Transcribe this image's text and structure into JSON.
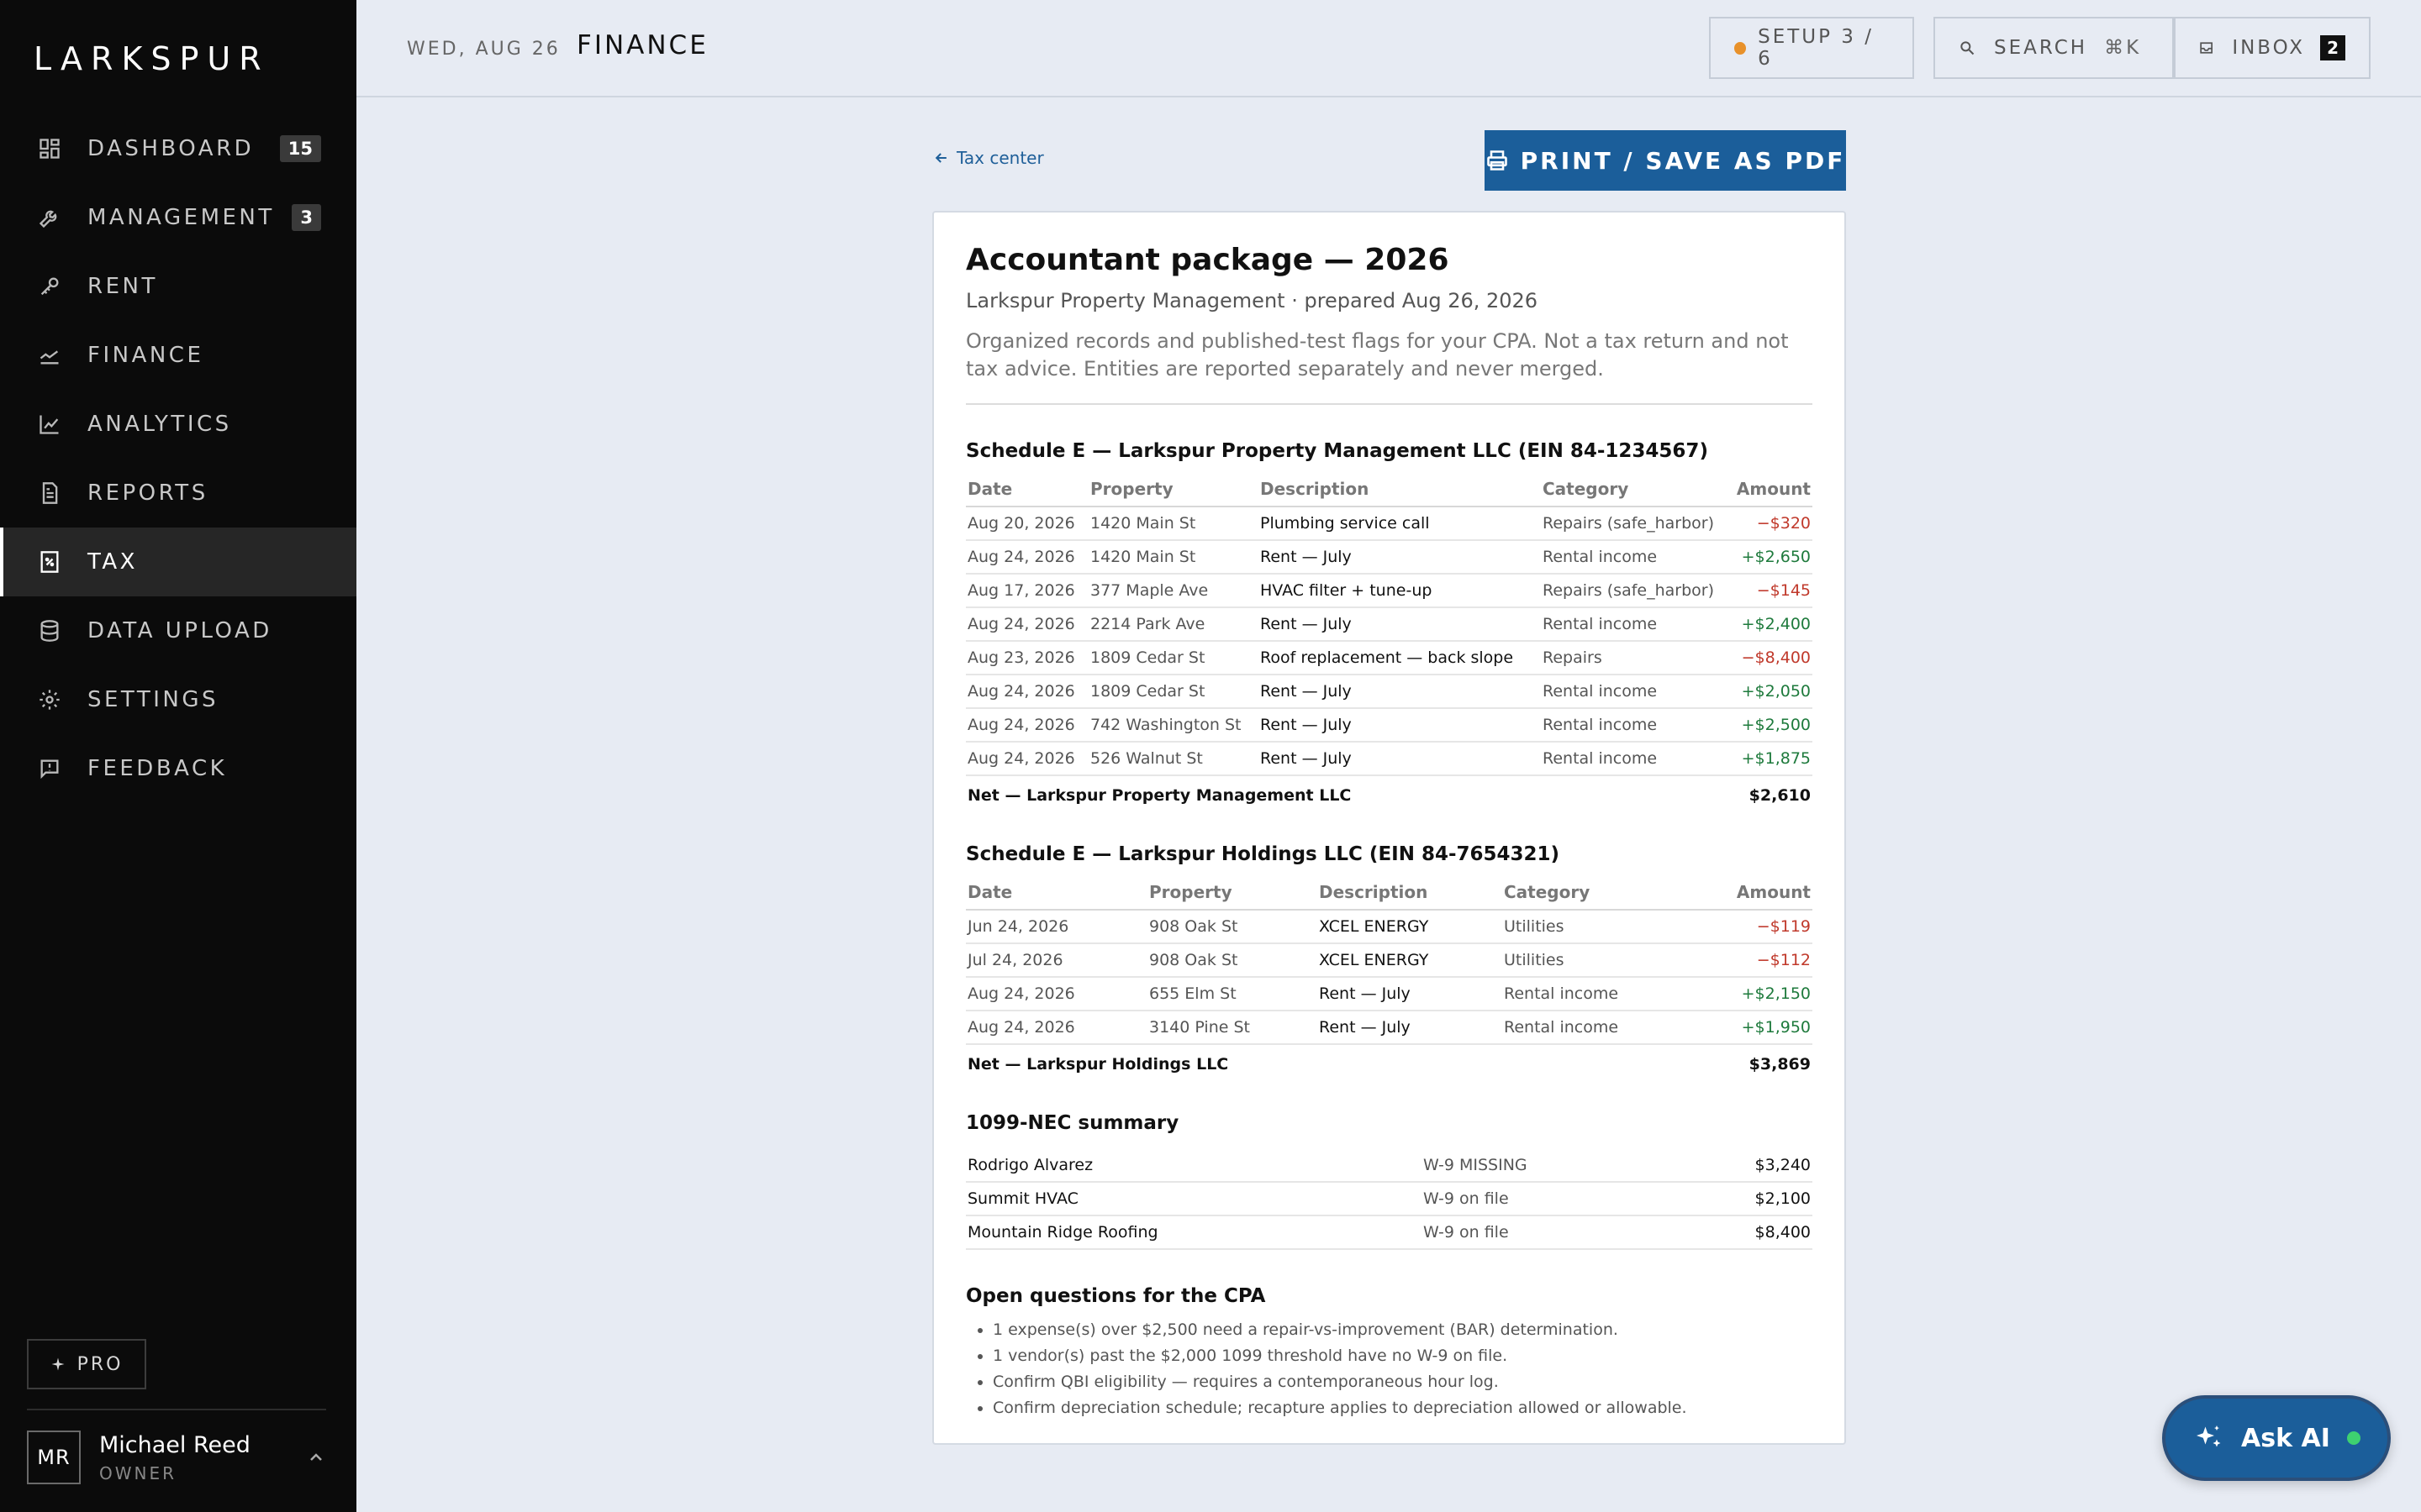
{
  "brand": "LARKSPUR",
  "nav": [
    {
      "label": "DASHBOARD",
      "icon": "dashboard-icon",
      "count": "15"
    },
    {
      "label": "MANAGEMENT",
      "icon": "wrench-icon",
      "count": "3"
    },
    {
      "label": "RENT",
      "icon": "key-icon"
    },
    {
      "label": "FINANCE",
      "icon": "finance-icon"
    },
    {
      "label": "ANALYTICS",
      "icon": "chart-icon"
    },
    {
      "label": "REPORTS",
      "icon": "document-icon"
    },
    {
      "label": "TAX",
      "icon": "tax-icon",
      "active": true
    },
    {
      "label": "DATA UPLOAD",
      "icon": "database-icon"
    },
    {
      "label": "SETTINGS",
      "icon": "gear-icon"
    },
    {
      "label": "FEEDBACK",
      "icon": "feedback-icon"
    }
  ],
  "pro_label": "PRO",
  "user": {
    "initials": "MR",
    "name": "Michael Reed",
    "role": "OWNER"
  },
  "header": {
    "date": "WED, AUG 26",
    "title": "FINANCE",
    "setup_label": "SETUP 3 / 6",
    "search_label": "SEARCH",
    "search_shortcut": "⌘K",
    "inbox_label": "INBOX",
    "inbox_count": "2"
  },
  "back_link": "Tax center",
  "print_label": "PRINT / SAVE AS PDF",
  "doc": {
    "title": "Accountant package — 2026",
    "subtitle": "Larkspur Property Management · prepared Aug 26, 2026",
    "note": "Organized records and published-test flags for your CPA. Not a tax return and not tax advice. Entities are reported separately and never merged."
  },
  "columns": [
    "Date",
    "Property",
    "Description",
    "Category",
    "Amount"
  ],
  "schedule1": {
    "title": "Schedule E — Larkspur Property Management LLC (EIN 84-1234567)",
    "rows": [
      {
        "date": "Aug 20, 2026",
        "property": "1420 Main St",
        "desc": "Plumbing service call",
        "cat": "Repairs (safe_harbor)",
        "amount": "−$320",
        "sign": "neg"
      },
      {
        "date": "Aug 24, 2026",
        "property": "1420 Main St",
        "desc": "Rent — July",
        "cat": "Rental income",
        "amount": "+$2,650",
        "sign": "pos"
      },
      {
        "date": "Aug 17, 2026",
        "property": "377 Maple Ave",
        "desc": "HVAC filter + tune-up",
        "cat": "Repairs (safe_harbor)",
        "amount": "−$145",
        "sign": "neg"
      },
      {
        "date": "Aug 24, 2026",
        "property": "2214 Park Ave",
        "desc": "Rent — July",
        "cat": "Rental income",
        "amount": "+$2,400",
        "sign": "pos"
      },
      {
        "date": "Aug 23, 2026",
        "property": "1809 Cedar St",
        "desc": "Roof replacement — back slope",
        "cat": "Repairs",
        "amount": "−$8,400",
        "sign": "neg"
      },
      {
        "date": "Aug 24, 2026",
        "property": "1809 Cedar St",
        "desc": "Rent — July",
        "cat": "Rental income",
        "amount": "+$2,050",
        "sign": "pos"
      },
      {
        "date": "Aug 24, 2026",
        "property": "742 Washington St",
        "desc": "Rent — July",
        "cat": "Rental income",
        "amount": "+$2,500",
        "sign": "pos"
      },
      {
        "date": "Aug 24, 2026",
        "property": "526 Walnut St",
        "desc": "Rent — July",
        "cat": "Rental income",
        "amount": "+$1,875",
        "sign": "pos"
      }
    ],
    "net_label": "Net — Larkspur Property Management LLC",
    "net_amount": "$2,610"
  },
  "schedule2": {
    "title": "Schedule E — Larkspur Holdings LLC (EIN 84-7654321)",
    "rows": [
      {
        "date": "Jun 24, 2026",
        "property": "908 Oak St",
        "desc": "XCEL ENERGY",
        "cat": "Utilities",
        "amount": "−$119",
        "sign": "neg"
      },
      {
        "date": "Jul 24, 2026",
        "property": "908 Oak St",
        "desc": "XCEL ENERGY",
        "cat": "Utilities",
        "amount": "−$112",
        "sign": "neg"
      },
      {
        "date": "Aug 24, 2026",
        "property": "655 Elm St",
        "desc": "Rent — July",
        "cat": "Rental income",
        "amount": "+$2,150",
        "sign": "pos"
      },
      {
        "date": "Aug 24, 2026",
        "property": "3140 Pine St",
        "desc": "Rent — July",
        "cat": "Rental income",
        "amount": "+$1,950",
        "sign": "pos"
      }
    ],
    "net_label": "Net — Larkspur Holdings LLC",
    "net_amount": "$3,869"
  },
  "nec": {
    "title": "1099-NEC summary",
    "rows": [
      {
        "name": "Rodrigo Alvarez",
        "status": "W-9 MISSING",
        "amount": "$3,240"
      },
      {
        "name": "Summit HVAC",
        "status": "W-9 on file",
        "amount": "$2,100"
      },
      {
        "name": "Mountain Ridge Roofing",
        "status": "W-9 on file",
        "amount": "$8,400"
      }
    ]
  },
  "questions": {
    "title": "Open questions for the CPA",
    "items": [
      "1 expense(s) over $2,500 need a repair-vs-improvement (BAR) determination.",
      "1 vendor(s) past the $2,000 1099 threshold have no W-9 on file.",
      "Confirm QBI eligibility — requires a contemporaneous hour log.",
      "Confirm depreciation schedule; recapture applies to depreciation allowed or allowable."
    ]
  },
  "ask_ai_label": "Ask AI",
  "colors": {
    "accent": "#1b5e9a",
    "negative": "#c0392b",
    "positive": "#1e7a3c",
    "setup_dot": "#e8912a",
    "online": "#3ed170"
  }
}
